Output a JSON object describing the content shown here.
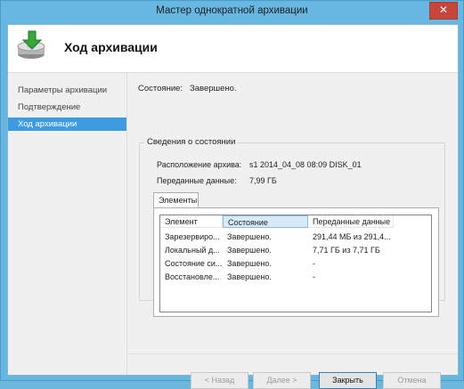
{
  "window": {
    "title": "Мастер однократной архивации",
    "close_glyph": "✕"
  },
  "header": {
    "title": "Ход архивации",
    "icon": "backup-drive-arrow-icon"
  },
  "nav": {
    "items": [
      {
        "label": "Параметры архивации",
        "active": false
      },
      {
        "label": "Подтверждение",
        "active": false
      },
      {
        "label": "Ход архивации",
        "active": true
      }
    ]
  },
  "status": {
    "label": "Состояние:",
    "value": "Завершено."
  },
  "details": {
    "title": "Сведения о состоянии",
    "location_label": "Расположение архива:",
    "location_value": "s1 2014_04_08 08:09 DISK_01",
    "transferred_label": "Переданные данные:",
    "transferred_value": "7,99 ГБ"
  },
  "tab": {
    "label": "Элементы"
  },
  "table": {
    "columns": [
      "Элемент",
      "Состояние",
      "Переданные данные"
    ],
    "rows": [
      [
        "Зарезервиро...",
        "Завершено.",
        "291,44 МБ из 291,4..."
      ],
      [
        "Локальный д...",
        "Завершено.",
        "7,71 ГБ из 7,71 ГБ"
      ],
      [
        "Состояние си...",
        "Завершено.",
        "-"
      ],
      [
        "Восстановле...",
        "Завершено.",
        "-"
      ]
    ]
  },
  "buttons": {
    "back": "< Назад",
    "next": "Далее >",
    "close": "Закрыть",
    "cancel": "Отмена"
  },
  "colors": {
    "title_bar": "#68b7e1",
    "active_nav": "#3c9be1",
    "close_button": "#c7463b"
  }
}
